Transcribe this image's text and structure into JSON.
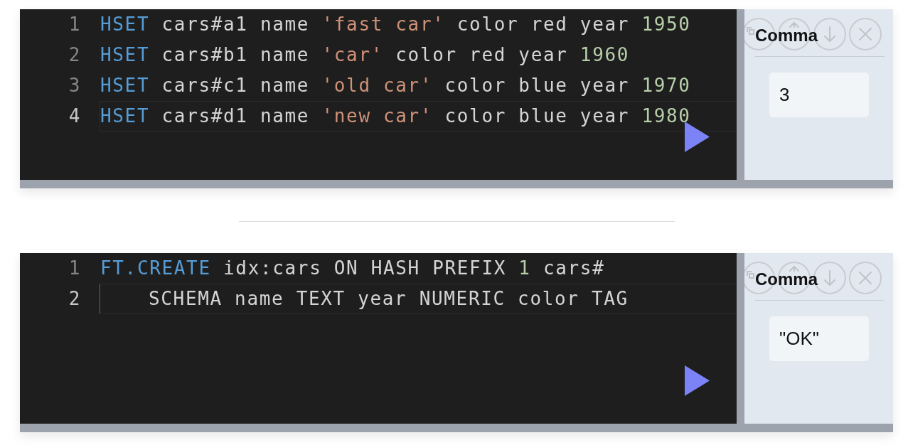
{
  "editors": [
    {
      "lines": [
        {
          "number": "1",
          "current": false,
          "indented": false,
          "tokens": [
            {
              "kind": "keyword",
              "text": "HSET"
            },
            {
              "kind": "plain",
              "text": " cars#a1 name "
            },
            {
              "kind": "string",
              "text": "'fast car'"
            },
            {
              "kind": "plain",
              "text": " color red year "
            },
            {
              "kind": "number",
              "text": "1950"
            }
          ]
        },
        {
          "number": "2",
          "current": false,
          "indented": false,
          "tokens": [
            {
              "kind": "keyword",
              "text": "HSET"
            },
            {
              "kind": "plain",
              "text": " cars#b1 name "
            },
            {
              "kind": "string",
              "text": "'car'"
            },
            {
              "kind": "plain",
              "text": " color red year "
            },
            {
              "kind": "number",
              "text": "1960"
            }
          ]
        },
        {
          "number": "3",
          "current": false,
          "indented": false,
          "tokens": [
            {
              "kind": "keyword",
              "text": "HSET"
            },
            {
              "kind": "plain",
              "text": " cars#c1 name "
            },
            {
              "kind": "string",
              "text": "'old car'"
            },
            {
              "kind": "plain",
              "text": " color blue year "
            },
            {
              "kind": "number",
              "text": "1970"
            }
          ]
        },
        {
          "number": "4",
          "current": true,
          "indented": false,
          "tokens": [
            {
              "kind": "keyword",
              "text": "HSET"
            },
            {
              "kind": "plain",
              "text": " cars#d1 name "
            },
            {
              "kind": "string",
              "text": "'new car'"
            },
            {
              "kind": "plain",
              "text": " color blue year "
            },
            {
              "kind": "number",
              "text": "1980"
            }
          ]
        }
      ],
      "panel": {
        "title": "Comma",
        "result": "3"
      }
    },
    {
      "lines": [
        {
          "number": "1",
          "current": false,
          "indented": false,
          "tokens": [
            {
              "kind": "keyword",
              "text": "FT.CREATE"
            },
            {
              "kind": "plain",
              "text": " idx:cars ON HASH PREFIX "
            },
            {
              "kind": "number",
              "text": "1"
            },
            {
              "kind": "plain",
              "text": " cars#"
            }
          ]
        },
        {
          "number": "2",
          "current": true,
          "indented": true,
          "tokens": [
            {
              "kind": "plain",
              "text": "SCHEMA name TEXT year NUMERIC color TAG"
            }
          ]
        }
      ],
      "panel": {
        "title": "Comma",
        "result": "\"OK\""
      }
    }
  ]
}
